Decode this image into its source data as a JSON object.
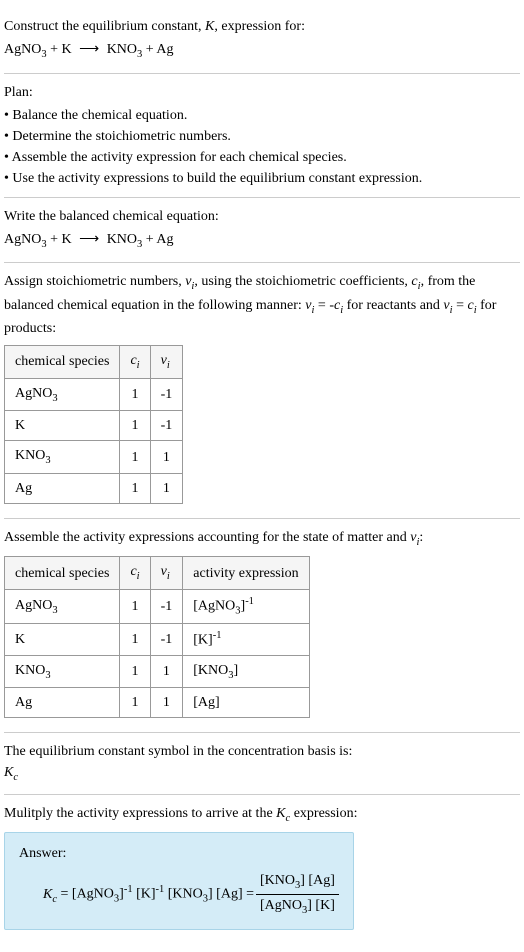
{
  "prompt": {
    "line1": "Construct the equilibrium constant, K, expression for:",
    "equation": "AgNO₃ + K ⟶ KNO₃ + Ag"
  },
  "plan": {
    "title": "Plan:",
    "items": [
      "• Balance the chemical equation.",
      "• Determine the stoichiometric numbers.",
      "• Assemble the activity expression for each chemical species.",
      "• Use the activity expressions to build the equilibrium constant expression."
    ]
  },
  "balanced": {
    "title": "Write the balanced chemical equation:",
    "equation": "AgNO₃ + K ⟶ KNO₃ + Ag"
  },
  "stoich": {
    "intro": "Assign stoichiometric numbers, νᵢ, using the stoichiometric coefficients, cᵢ, from the balanced chemical equation in the following manner: νᵢ = -cᵢ for reactants and νᵢ = cᵢ for products:",
    "headers": {
      "h1": "chemical species",
      "h2": "cᵢ",
      "h3": "νᵢ"
    },
    "rows": [
      {
        "species": "AgNO₃",
        "ci": "1",
        "vi": "-1"
      },
      {
        "species": "K",
        "ci": "1",
        "vi": "-1"
      },
      {
        "species": "KNO₃",
        "ci": "1",
        "vi": "1"
      },
      {
        "species": "Ag",
        "ci": "1",
        "vi": "1"
      }
    ]
  },
  "activity": {
    "intro": "Assemble the activity expressions accounting for the state of matter and νᵢ:",
    "headers": {
      "h1": "chemical species",
      "h2": "cᵢ",
      "h3": "νᵢ",
      "h4": "activity expression"
    },
    "rows": [
      {
        "species": "AgNO₃",
        "ci": "1",
        "vi": "-1",
        "expr": "[AgNO₃]⁻¹"
      },
      {
        "species": "K",
        "ci": "1",
        "vi": "-1",
        "expr": "[K]⁻¹"
      },
      {
        "species": "KNO₃",
        "ci": "1",
        "vi": "1",
        "expr": "[KNO₃]"
      },
      {
        "species": "Ag",
        "ci": "1",
        "vi": "1",
        "expr": "[Ag]"
      }
    ]
  },
  "symbol": {
    "line1": "The equilibrium constant symbol in the concentration basis is:",
    "line2": "K_c"
  },
  "multiply": {
    "intro": "Mulitply the activity expressions to arrive at the K_c expression:"
  },
  "answer": {
    "label": "Answer:",
    "lhs": "K_c = [AgNO₃]⁻¹ [K]⁻¹ [KNO₃] [Ag] = ",
    "num": "[KNO₃] [Ag]",
    "den": "[AgNO₃] [K]"
  },
  "chart_data": {
    "type": "table",
    "tables": [
      {
        "title": "Stoichiometric numbers",
        "columns": [
          "chemical species",
          "c_i",
          "ν_i"
        ],
        "rows": [
          [
            "AgNO3",
            1,
            -1
          ],
          [
            "K",
            1,
            -1
          ],
          [
            "KNO3",
            1,
            1
          ],
          [
            "Ag",
            1,
            1
          ]
        ]
      },
      {
        "title": "Activity expressions",
        "columns": [
          "chemical species",
          "c_i",
          "ν_i",
          "activity expression"
        ],
        "rows": [
          [
            "AgNO3",
            1,
            -1,
            "[AgNO3]^-1"
          ],
          [
            "K",
            1,
            -1,
            "[K]^-1"
          ],
          [
            "KNO3",
            1,
            1,
            "[KNO3]"
          ],
          [
            "Ag",
            1,
            1,
            "[Ag]"
          ]
        ]
      }
    ],
    "equilibrium_constant": "K_c = ([KNO3][Ag]) / ([AgNO3][K])"
  }
}
